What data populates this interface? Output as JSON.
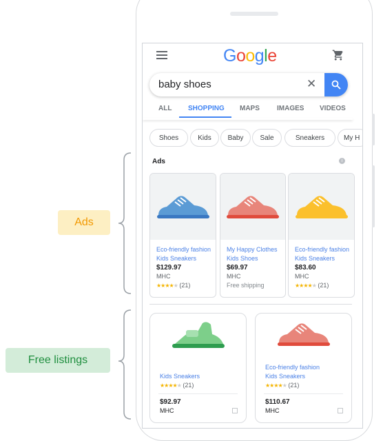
{
  "annotations": {
    "ads_label": "Ads",
    "free_label": "Free listings"
  },
  "header": {
    "logo": "Google",
    "menu_icon": "menu-icon",
    "cart_icon": "cart-icon"
  },
  "search": {
    "value": "baby shoes"
  },
  "tabs": [
    {
      "label": "ALL"
    },
    {
      "label": "SHOPPING",
      "active": true
    },
    {
      "label": "MAPS"
    },
    {
      "label": "IMAGES"
    },
    {
      "label": "VIDEOS"
    }
  ],
  "chips": [
    "Shoes",
    "Kids",
    "Baby",
    "Sale",
    "Sneakers",
    "My H"
  ],
  "ads": {
    "heading": "Ads",
    "items": [
      {
        "title1": "Eco-friendly fashion",
        "title2": "Kids Sneakers",
        "price": "$129.97",
        "seller": "MHC",
        "rating": 4.5,
        "reviews": "(21)",
        "color": "#5b9bd5"
      },
      {
        "title1": "My Happy Clothes",
        "title2": "Kids Shoes",
        "price": "$69.97",
        "seller": "MHC",
        "shipping": "Free shipping",
        "color": "#e8857a"
      },
      {
        "title1": "Eco-friendly fashion",
        "title2": "Kids Sneakers",
        "price": "$83.60",
        "seller": "MHC",
        "rating": 4.5,
        "reviews": "(21)",
        "color": "#fbc02d"
      }
    ]
  },
  "free": {
    "items": [
      {
        "title1": "",
        "title2": "Kids Sneakers",
        "price": "$92.97",
        "seller": "MHC",
        "rating": 4.5,
        "reviews": "(21)",
        "color": "#7dcf8a"
      },
      {
        "title1": "Eco-friendly fashion",
        "title2": "Kids Sneakers",
        "price": "$110.67",
        "seller": "MHC",
        "rating": 4.5,
        "reviews": "(21)",
        "color": "#e8857a"
      }
    ]
  },
  "colors": {
    "accent": "#4285f4",
    "ads_bg": "#fdefc3",
    "ads_text": "#f29900",
    "free_bg": "#d3ecd9",
    "free_text": "#1e8e3e"
  }
}
